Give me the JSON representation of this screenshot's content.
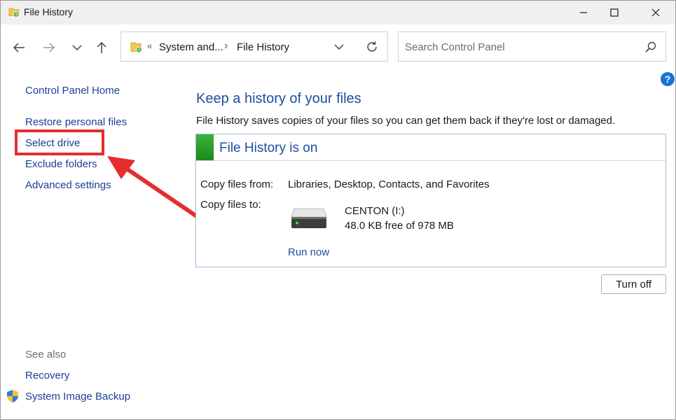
{
  "window": {
    "title": "File History"
  },
  "address": {
    "crumb_separator": "«",
    "crumb_1": "System and...",
    "crumb_arrow": "›",
    "crumb_2": "File History"
  },
  "search": {
    "placeholder": "Search Control Panel"
  },
  "help": {
    "label": "?"
  },
  "sidebar": {
    "home": "Control Panel Home",
    "items": [
      {
        "label": "Restore personal files"
      },
      {
        "label": "Select drive"
      },
      {
        "label": "Exclude folders"
      },
      {
        "label": "Advanced settings"
      }
    ],
    "see_also_heading": "See also",
    "see_also": [
      {
        "label": "Recovery"
      },
      {
        "label": "System Image Backup"
      }
    ]
  },
  "main": {
    "heading": "Keep a history of your files",
    "description": "File History saves copies of your files so you can get them back if they're lost or damaged.",
    "status": "File History is on",
    "status_color": "#2a9d2a",
    "copy_from_label": "Copy files from:",
    "copy_from_value": "Libraries, Desktop, Contacts, and Favorites",
    "copy_to_label": "Copy files to:",
    "drive_name": "CENTON (I:)",
    "drive_free": "48.0 KB free of 978 MB",
    "run_now": "Run now",
    "turn_off": "Turn off"
  },
  "annotation": {
    "color": "#e52d2d"
  }
}
